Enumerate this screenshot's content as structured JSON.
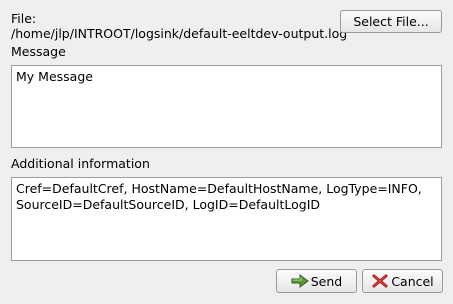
{
  "file": {
    "label": "File:",
    "path": "/home/jlp/INTROOT/logsink/default-eeltdev-output.log",
    "select_button": "Select File..."
  },
  "message": {
    "label": "Message",
    "value": "My Message"
  },
  "additional": {
    "label": "Additional information",
    "value": "Cref=DefaultCref, HostName=DefaultHostName, LogType=INFO,\nSourceID=DefaultSourceID, LogID=DefaultLogID"
  },
  "buttons": {
    "send": "Send",
    "send_icon": "send-arrow-icon",
    "cancel": "Cancel",
    "cancel_icon": "cancel-x-icon"
  }
}
